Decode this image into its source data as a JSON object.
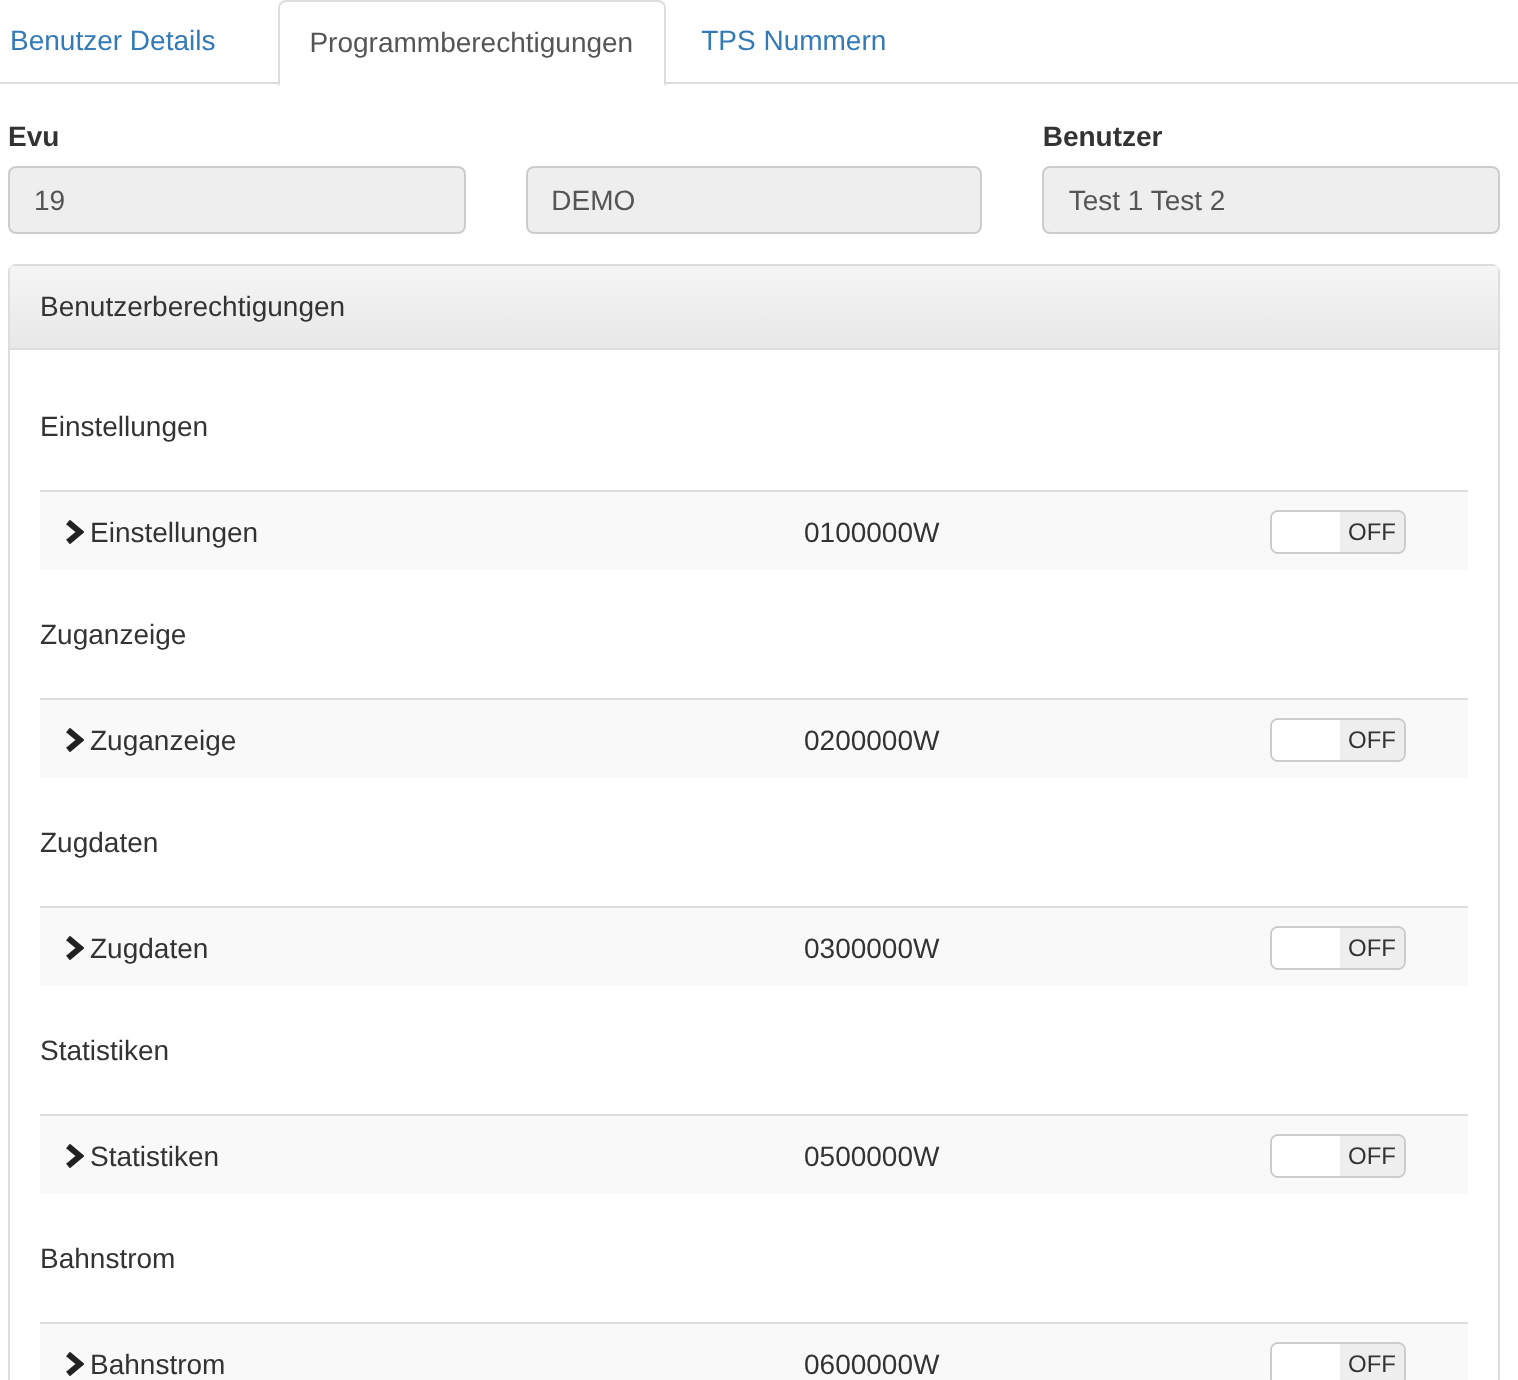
{
  "tabs": [
    {
      "label": "Benutzer Details",
      "selected": false
    },
    {
      "label": "Programmberechtigungen",
      "selected": true
    },
    {
      "label": "TPS Nummern",
      "selected": false
    }
  ],
  "fields": [
    {
      "label": "Evu",
      "value": "19"
    },
    {
      "value": "DEMO"
    },
    {
      "label": "Benutzer",
      "value": "Test 1 Test 2"
    }
  ],
  "panel": {
    "title": "Benutzerberechtigungen",
    "groups": [
      {
        "title": "Einstellungen",
        "items": [
          {
            "name": "Einstellungen",
            "code": "0100000W",
            "on": false,
            "switch_label": "OFF"
          }
        ]
      },
      {
        "title": "Zuganzeige",
        "items": [
          {
            "name": "Zuganzeige",
            "code": "0200000W",
            "on": false,
            "switch_label": "OFF"
          }
        ]
      },
      {
        "title": "Zugdaten",
        "items": [
          {
            "name": "Zugdaten",
            "code": "0300000W",
            "on": false,
            "switch_label": "OFF"
          }
        ]
      },
      {
        "title": "Statistiken",
        "items": [
          {
            "name": "Statistiken",
            "code": "0500000W",
            "on": false,
            "switch_label": "OFF"
          }
        ]
      },
      {
        "title": "Bahnstrom",
        "items": [
          {
            "name": "Bahnstrom",
            "code": "0600000W",
            "on": false,
            "switch_label": "OFF"
          }
        ]
      }
    ]
  }
}
